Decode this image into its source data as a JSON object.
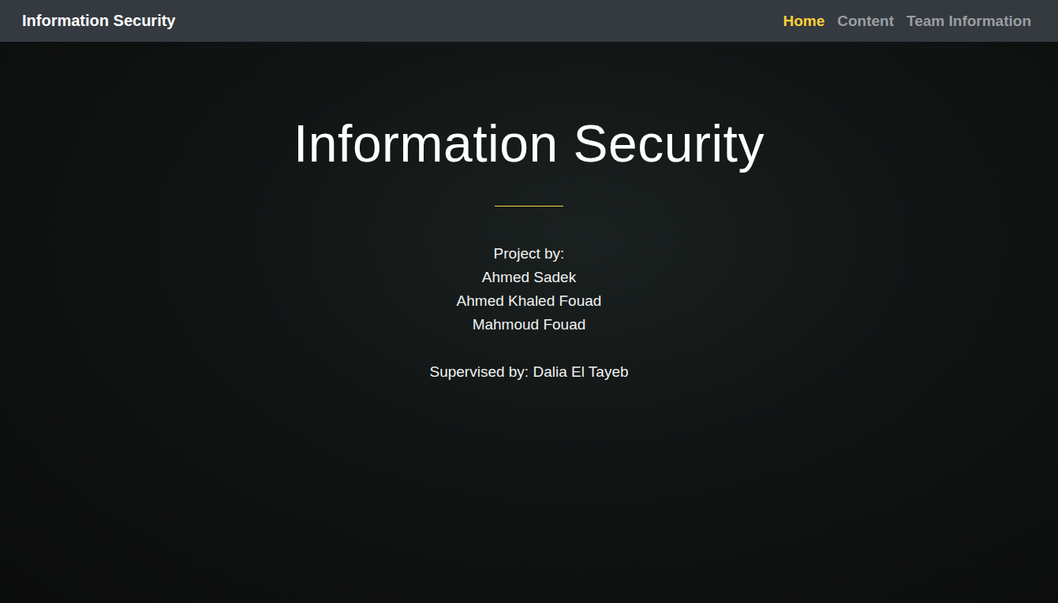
{
  "navbar": {
    "brand": "Information Security",
    "links": [
      {
        "label": "Home",
        "selected": true
      },
      {
        "label": "Content",
        "selected": false
      },
      {
        "label": "Team Information",
        "selected": false
      }
    ]
  },
  "hero": {
    "title": "Information Security",
    "project_label": "Project by:",
    "authors": [
      "Ahmed Sadek",
      "Ahmed Khaled Fouad",
      "Mahmoud Fouad"
    ],
    "supervisor": "Supervised by: Dalia El Tayeb"
  }
}
